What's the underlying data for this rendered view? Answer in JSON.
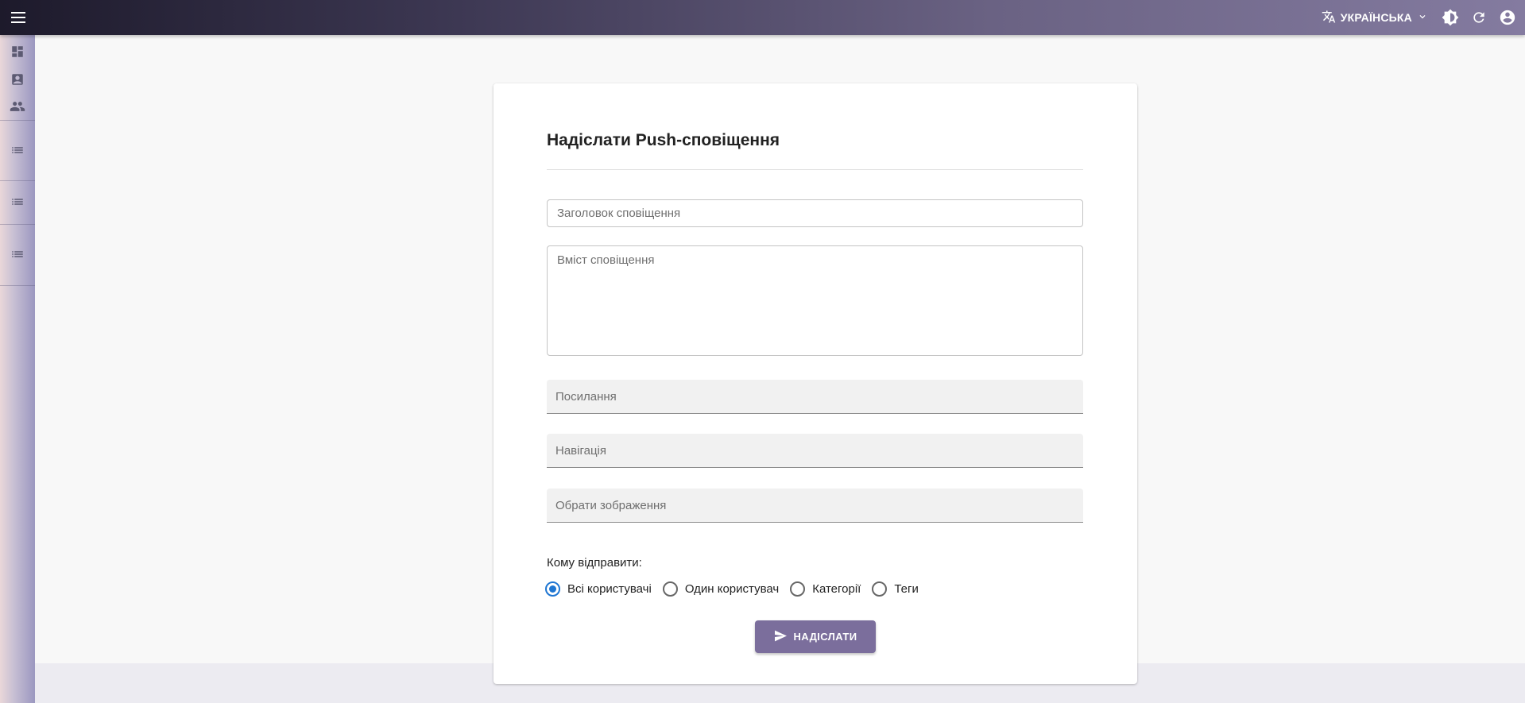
{
  "appbar": {
    "menu_icon": "menu-icon",
    "language_label": "УКРАЇНСЬКА",
    "icons": [
      "translate-icon",
      "chevron-down-icon",
      "theme-toggle-icon",
      "refresh-icon",
      "account-icon"
    ]
  },
  "rail": {
    "items": [
      {
        "icon": "dashboard-icon"
      },
      {
        "icon": "contact-card-icon"
      },
      {
        "icon": "people-icon"
      },
      {
        "icon": "list-icon"
      },
      {
        "icon": "list-icon"
      },
      {
        "icon": "list-icon"
      }
    ]
  },
  "form": {
    "title": "Надіслати Push-сповіщення",
    "title_placeholder": "Заголовок сповіщення",
    "body_placeholder": "Вміст сповіщення",
    "link_placeholder": "Посилання",
    "navigation_placeholder": "Навігація",
    "image_placeholder": "Обрати зображення",
    "recipients_label": "Кому відправити:",
    "recipient_options": [
      {
        "label": "Всі користувачі",
        "selected": true
      },
      {
        "label": "Один користувач",
        "selected": false
      },
      {
        "label": "Категорії",
        "selected": false
      },
      {
        "label": "Теги",
        "selected": false
      }
    ],
    "send_label": "НАДІСЛАТИ"
  },
  "colors": {
    "accent": "#7b6e9c",
    "radio_selected": "#1f76d2",
    "appbar_start": "#1d1a2b",
    "appbar_end": "#847ba0"
  }
}
